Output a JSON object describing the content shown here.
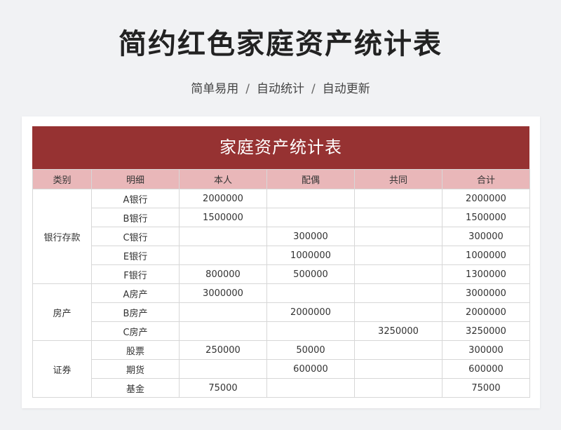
{
  "page": {
    "title": "简约红色家庭资产统计表",
    "subtitle": [
      "简单易用",
      "/",
      "自动统计",
      "/",
      "自动更新"
    ]
  },
  "sheet": {
    "banner": "家庭资产统计表",
    "headers": [
      "类别",
      "明细",
      "本人",
      "配偶",
      "共同",
      "合计"
    ],
    "groups": [
      {
        "category": "银行存款",
        "rows": [
          [
            "A银行",
            "2000000",
            "",
            "",
            "2000000"
          ],
          [
            "B银行",
            "1500000",
            "",
            "",
            "1500000"
          ],
          [
            "C银行",
            "",
            "300000",
            "",
            "300000"
          ],
          [
            "E银行",
            "",
            "1000000",
            "",
            "1000000"
          ],
          [
            "F银行",
            "800000",
            "500000",
            "",
            "1300000"
          ]
        ]
      },
      {
        "category": "房产",
        "rows": [
          [
            "A房产",
            "3000000",
            "",
            "",
            "3000000"
          ],
          [
            "B房产",
            "",
            "2000000",
            "",
            "2000000"
          ],
          [
            "C房产",
            "",
            "",
            "3250000",
            "3250000"
          ]
        ]
      },
      {
        "category": "证券",
        "rows": [
          [
            "股票",
            "250000",
            "50000",
            "",
            "300000"
          ],
          [
            "期货",
            "",
            "600000",
            "",
            "600000"
          ],
          [
            "基金",
            "75000",
            "",
            "",
            "75000"
          ]
        ]
      }
    ]
  },
  "colors": {
    "banner": "#963232",
    "header": "#e9b7b9",
    "background": "#f1f2f4"
  }
}
